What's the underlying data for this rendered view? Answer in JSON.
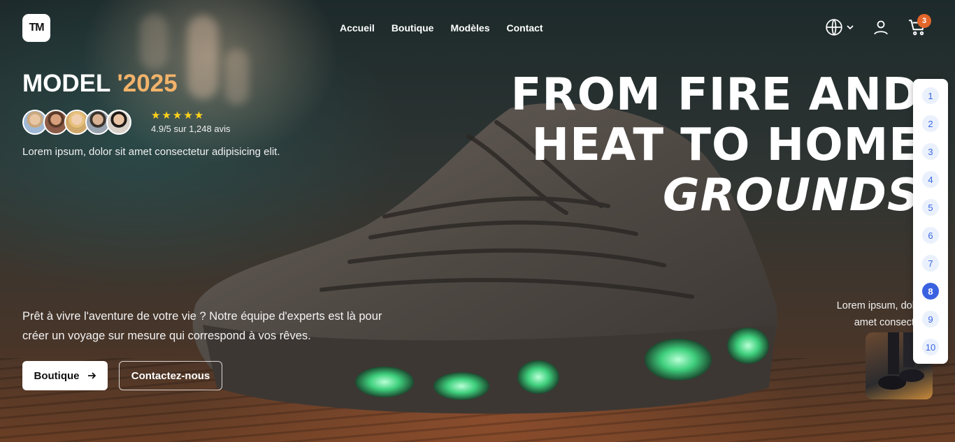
{
  "brand": {
    "logo_text": "TM"
  },
  "nav": {
    "items": [
      "Accueil",
      "Boutique",
      "Modèles",
      "Contact"
    ]
  },
  "header_icons": {
    "language": "globe-icon",
    "account": "user-icon",
    "cart": "cart-icon",
    "cart_count": "3"
  },
  "hero": {
    "model_label": "MODEL",
    "model_year": "'2025",
    "rating_stars": "★★★★★",
    "rating_text": "4.9/5 sur 1,248 avis",
    "lead": "Lorem ipsum, dolor sit amet consectetur adipisicing elit.",
    "headline_line1": "FROM FIRE AND",
    "headline_line2": "HEAT TO HOME",
    "headline_line3": "GROUNDS",
    "pitch": "Prêt à vivre l'aventure de votre vie ? Notre équipe d'experts est là pour créer un voyage sur mesure qui correspond à vos rêves.",
    "primary_button": "Boutique",
    "secondary_button": "Contactez-nous",
    "side_lead_line1": "Lorem ipsum, dolo",
    "side_lead_line2": "amet consecte"
  },
  "pager": {
    "pages": [
      "1",
      "2",
      "3",
      "4",
      "5",
      "6",
      "7",
      "8",
      "9",
      "10"
    ],
    "active": "8"
  },
  "colors": {
    "accent_year": "#f2b36b",
    "star": "#ffd21a",
    "cart_badge": "#e2652a",
    "pager_active": "#3a62e0"
  }
}
